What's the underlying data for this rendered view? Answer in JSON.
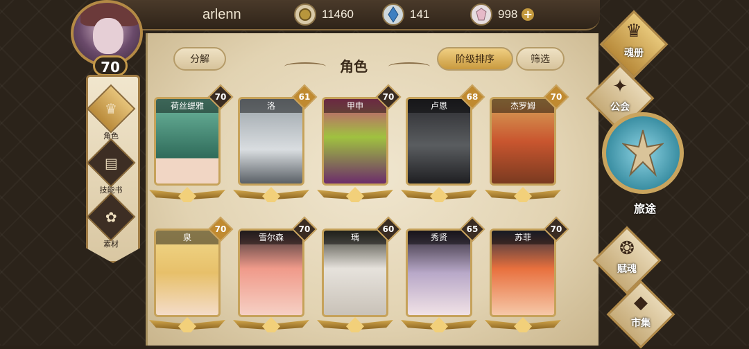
{
  "player": {
    "name": "arlenn",
    "level": "70"
  },
  "resources": [
    {
      "icon": "gold-coin-icon",
      "value": "11460"
    },
    {
      "icon": "blue-crystal-icon",
      "value": "141"
    },
    {
      "icon": "gem-icon",
      "value": "998"
    }
  ],
  "header": {
    "title": "角色",
    "decompose": "分解",
    "sort": "阶级排序",
    "filter": "筛选"
  },
  "sidebar": [
    {
      "label": "角色",
      "icon": "character-icon",
      "active": true
    },
    {
      "label": "技能书",
      "icon": "skill-book-icon",
      "active": false
    },
    {
      "label": "素材",
      "icon": "material-icon",
      "active": false
    }
  ],
  "characters": [
    {
      "name": "荷丝缇雅",
      "level": "70"
    },
    {
      "name": "洛",
      "level": "61"
    },
    {
      "name": "甲申",
      "level": "70"
    },
    {
      "name": "卢恩",
      "level": "68"
    },
    {
      "name": "杰罗姆",
      "level": "70"
    },
    {
      "name": "泉",
      "level": "70"
    },
    {
      "name": "雪尔森",
      "level": "70"
    },
    {
      "name": "瑀",
      "level": "60"
    },
    {
      "name": "秀贤",
      "level": "65"
    },
    {
      "name": "苏菲",
      "level": "70"
    }
  ],
  "right_nav": {
    "soulbook": "魂册",
    "guild": "公会",
    "journey": "旅途",
    "fuhun": "赋魂",
    "market": "市集"
  },
  "colors": {
    "accent_gold": "#c9a35e",
    "parchment": "#e8dcc0",
    "journey_teal": "#3b8fa3"
  }
}
